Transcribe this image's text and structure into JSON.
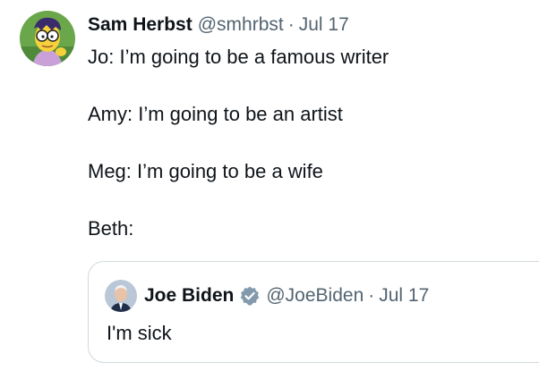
{
  "tweet": {
    "author_name": "Sam Herbst",
    "author_handle": "@smhrbst",
    "separator": "·",
    "date": "Jul 17",
    "lines": [
      "Jo: I’m going to be a famous writer",
      "",
      "Amy: I’m going to be an artist",
      "",
      "Meg: I’m going to be a wife",
      "",
      "Beth:"
    ]
  },
  "quoted_tweet": {
    "author_name": "Joe Biden",
    "author_handle": "@JoeBiden",
    "separator": "·",
    "date": "Jul 17",
    "text": "I'm sick",
    "verified_icon": "verified-badge-icon"
  },
  "colors": {
    "text_primary": "#0f1419",
    "text_secondary": "#536471",
    "border": "#cfd9de",
    "verified": "#829aab"
  }
}
